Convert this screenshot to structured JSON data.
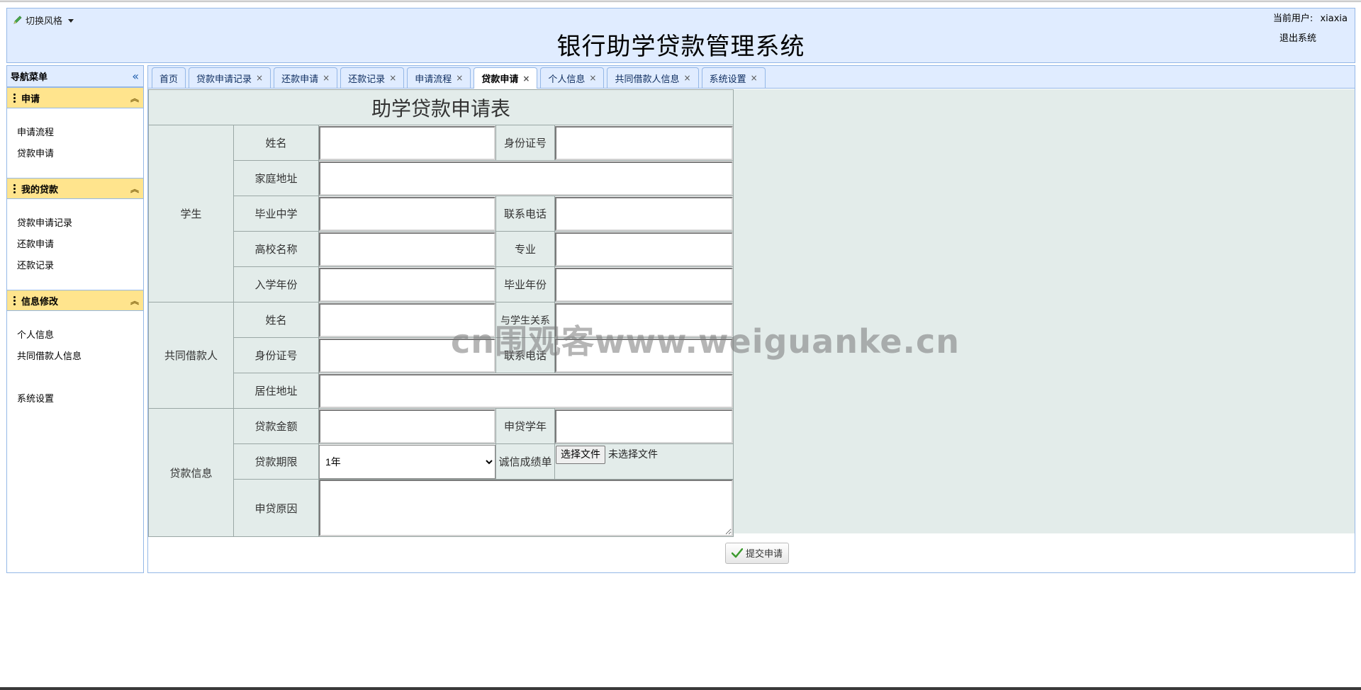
{
  "header": {
    "style_switch": "切换风格",
    "title": "银行助学贷款管理系统",
    "current_user_label": "当前用户:",
    "current_user": "xiaxia",
    "logout": "退出系统"
  },
  "sidebar": {
    "title": "导航菜单",
    "groups": [
      {
        "title": "申请",
        "items": [
          "申请流程",
          "贷款申请"
        ]
      },
      {
        "title": "我的贷款",
        "items": [
          "贷款申请记录",
          "还款申请",
          "还款记录"
        ]
      },
      {
        "title": "信息修改",
        "items": [
          "个人信息",
          "共同借款人信息",
          "",
          "系统设置"
        ]
      }
    ]
  },
  "tabs": [
    {
      "label": "首页",
      "closable": false
    },
    {
      "label": "贷款申请记录",
      "closable": true
    },
    {
      "label": "还款申请",
      "closable": true
    },
    {
      "label": "还款记录",
      "closable": true
    },
    {
      "label": "申请流程",
      "closable": true
    },
    {
      "label": "贷款申请",
      "closable": true,
      "active": true
    },
    {
      "label": "个人信息",
      "closable": true
    },
    {
      "label": "共同借款人信息",
      "closable": true
    },
    {
      "label": "系统设置",
      "closable": true
    }
  ],
  "form": {
    "title": "助学贷款申请表",
    "sections": {
      "student": "学生",
      "co_borrower": "共同借款人",
      "loan": "贷款信息"
    },
    "labels": {
      "student_name": "姓名",
      "student_id": "身份证号",
      "home_address": "家庭地址",
      "high_school": "毕业中学",
      "student_phone": "联系电话",
      "university": "高校名称",
      "major": "专业",
      "enroll_year": "入学年份",
      "grad_year": "毕业年份",
      "co_name": "姓名",
      "relation": "与学生关系",
      "co_id": "身份证号",
      "co_phone": "联系电话",
      "residence": "居住地址",
      "amount": "贷款金额",
      "school_year": "申贷学年",
      "term": "贷款期限",
      "credit_report": "诚信成绩单",
      "reason": "申贷原因"
    },
    "term_value": "1年",
    "file_button": "选择文件",
    "file_status": "未选择文件",
    "submit": "提交申请"
  },
  "watermark": "cn围观客www.weiguanke.cn"
}
